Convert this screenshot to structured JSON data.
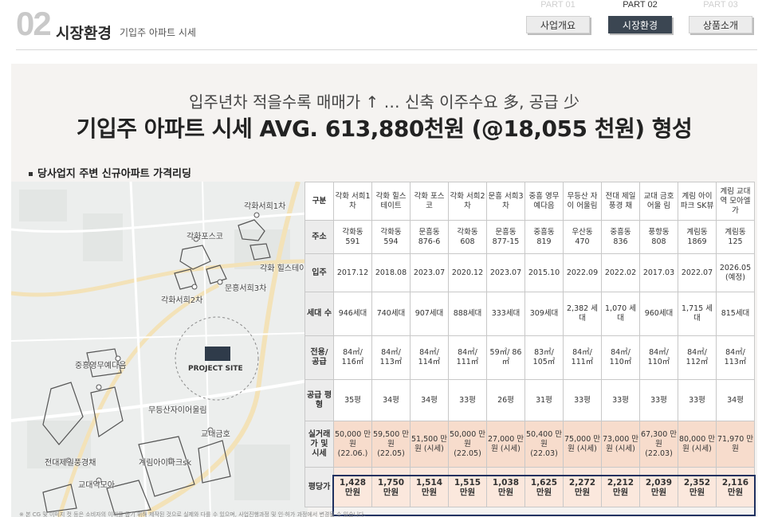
{
  "header": {
    "number": "02",
    "title": "시장환경",
    "subtitle": "기입주 아파트 시세"
  },
  "parts": [
    {
      "part_label": "PART 01",
      "button": "사업개요",
      "active": false
    },
    {
      "part_label": "PART 02",
      "button": "시장환경",
      "active": true
    },
    {
      "part_label": "PART 03",
      "button": "상품소개",
      "active": false
    }
  ],
  "headline": {
    "line1": "입주년차 적을수록 매매가 ↑ … 신축 이주수요 多, 공급 少",
    "line2": "기입주 아파트 시세 AVG. 613,880천원 (@18,055 천원) 형성"
  },
  "section_title": "당사업지 주변 신규아파트 가격리딩",
  "map": {
    "project_site": "PROJECT SITE",
    "labels": [
      {
        "id": "gakhwa1",
        "text": "각화서희1차"
      },
      {
        "id": "gakhwapos",
        "text": "각화포스코"
      },
      {
        "id": "gakhwahill",
        "text": "각화 힐스테이트"
      },
      {
        "id": "munheung3",
        "text": "문흥서희3차"
      },
      {
        "id": "gakhwa2",
        "text": "각화서희2차"
      },
      {
        "id": "junghung",
        "text": "중흥영무예다음"
      },
      {
        "id": "mudeung",
        "text": "무등산자이어울림"
      },
      {
        "id": "gyodae",
        "text": "교대금호"
      },
      {
        "id": "jeondae",
        "text": "전대제일풍경채"
      },
      {
        "id": "gyerim",
        "text": "계림아이파크sk"
      },
      {
        "id": "gyodae2",
        "text": "교대역모아"
      }
    ]
  },
  "table": {
    "row_headers": {
      "name": "구분",
      "address": "주소",
      "movein": "입주",
      "households": "세대 수",
      "area": "전용/ 공급",
      "pyeong": "공급 평형",
      "price": "실거래가 및 시세",
      "ppy": "평당가"
    },
    "columns": [
      {
        "name": "각화 서희1차",
        "address": "각화동 591",
        "movein": "2017.12",
        "households": "946세대",
        "area": "84㎡/ 116㎡",
        "pyeong": "35평",
        "price": "50,000 만원 (22.06.)",
        "ppy": "1,428 만원"
      },
      {
        "name": "각화 힐스테이트",
        "address": "각화동 594",
        "movein": "2018.08",
        "households": "740세대",
        "area": "84㎡/ 113㎡",
        "pyeong": "34평",
        "price": "59,500 만원 (22.05)",
        "ppy": "1,750 만원"
      },
      {
        "name": "각화 포스코",
        "address": "문흥동 876-6",
        "movein": "2023.07",
        "households": "907세대",
        "area": "84㎡/ 114㎡",
        "pyeong": "34평",
        "price": "51,500 만원 (시세)",
        "ppy": "1,514 만원"
      },
      {
        "name": "각화 서희2차",
        "address": "각화동 608",
        "movein": "2020.12",
        "households": "888세대",
        "area": "84㎡/ 111㎡",
        "pyeong": "33평",
        "price": "50,000 만원 (22.05)",
        "ppy": "1,515 만원"
      },
      {
        "name": "문흥 서희3차",
        "address": "문흥동 877-15",
        "movein": "2023.07",
        "households": "333세대",
        "area": "59㎡/ 86㎡",
        "pyeong": "26평",
        "price": "27,000 만원 (시세)",
        "ppy": "1,038 만원"
      },
      {
        "name": "중흥 영무예다음",
        "address": "중흥동 819",
        "movein": "2015.10",
        "households": "309세대",
        "area": "83㎡/ 105㎡",
        "pyeong": "31평",
        "price": "50,400 만원 (22.03)",
        "ppy": "1,625 만원"
      },
      {
        "name": "무등산 자이 어울림",
        "address": "우산동 470",
        "movein": "2022.09",
        "households": "2,382 세대",
        "area": "84㎡/ 111㎡",
        "pyeong": "33평",
        "price": "75,000 만원 (시세)",
        "ppy": "2,272 만원"
      },
      {
        "name": "전대 제일풍경 채",
        "address": "중흥동 836",
        "movein": "2022.02",
        "households": "1,070 세대",
        "area": "84㎡/ 110㎡",
        "pyeong": "33평",
        "price": "73,000 만원 (시세)",
        "ppy": "2,212 만원"
      },
      {
        "name": "교대 금호어울 림",
        "address": "풍향동 808",
        "movein": "2017.03",
        "households": "960세대",
        "area": "84㎡/ 110㎡",
        "pyeong": "33평",
        "price": "67,300 만원 (22.03)",
        "ppy": "2,039 만원"
      },
      {
        "name": "계림 아이파크 SK뷰",
        "address": "계림동 1869",
        "movein": "2022.07",
        "households": "1,715 세대",
        "area": "84㎡/ 112㎡",
        "pyeong": "33평",
        "price": "80,000 만원 (시세)",
        "ppy": "2,352 만원"
      },
      {
        "name": "계림 교대역 모아엘가",
        "address": "계림동 125",
        "movein": "2026.05 (예정)",
        "households": "815세대",
        "area": "84㎡/ 113㎡",
        "pyeong": "34평",
        "price": "71,970 만원",
        "ppy": "2,116 만원"
      }
    ]
  },
  "footnote": "※ 본 CG 및 이미지 컷 등은 소비자의 이해를 돕기 위해 제작된 것으로 실제와 다를 수 있으며, 사업진행과정 및 인·허가 과정에서 변경될 수 있습니다."
}
